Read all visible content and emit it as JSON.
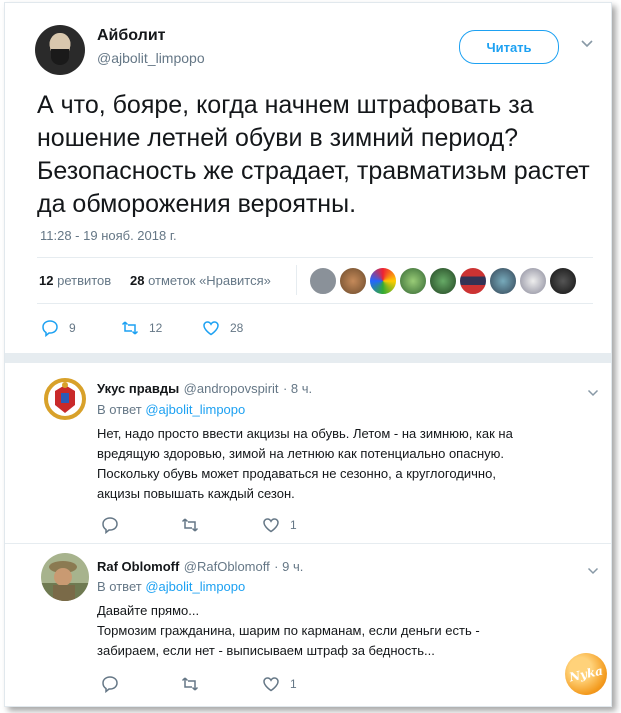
{
  "tweet": {
    "author_name": "Айболит",
    "author_handle": "@ajbolit_limpopo",
    "follow_label": "Читать",
    "text": "А что, бояре, когда начнем штрафовать за ношение летней обуви в зимний период? Безопасность же страдает, травматизьм растет да обморожения вероятны.",
    "timestamp": "11:28 - 19 нояб. 2018 г.",
    "retweets_count": "12",
    "retweets_label": "ретвитов",
    "likes_count": "28",
    "likes_label": "отметок «Нравится»",
    "actions": {
      "reply_count": "9",
      "retweet_count": "12",
      "like_count": "28"
    }
  },
  "replies": [
    {
      "name": "Укус правды",
      "handle": "@andropovspirit",
      "time": "· 8 ч.",
      "reply_to_prefix": "В ответ",
      "reply_to_handle": "@ajbolit_limpopo",
      "text_lines": [
        "Нет, надо просто ввести акцизы на обувь. Летом - на зимнюю, как на",
        "вредящую здоровью, зимой на летнюю как потенциально опасную.",
        "Поскольку обувь может продаваться не сезонно, а круглогодично,",
        "акцизы повышать каждый сезон."
      ],
      "like_count": "1"
    },
    {
      "name": "Raf Oblomoff",
      "handle": "@RafOblomoff",
      "time": "· 9 ч.",
      "reply_to_prefix": "В ответ",
      "reply_to_handle": "@ajbolit_limpopo",
      "text_lines": [
        "Давайте прямо...",
        "Тормозим гражданина, шарим по карманам, если деньги есть -",
        "забираем, если нет - выписываем штраф за бедность..."
      ],
      "like_count": "1"
    }
  ],
  "watermark": "Nyka",
  "colors": {
    "accent": "#1da1f2",
    "muted": "#657786",
    "text": "#14171a"
  }
}
